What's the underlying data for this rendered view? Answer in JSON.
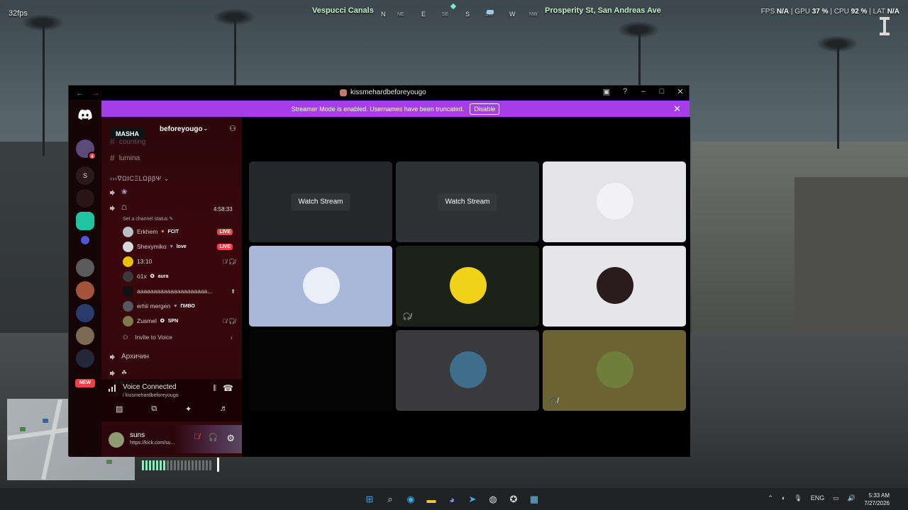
{
  "hud": {
    "fps": "32fps",
    "location_left": "Vespucci Canals",
    "location_right": "Prosperity St, San Andreas Ave",
    "compass": [
      "N",
      "NE",
      "E",
      "SE",
      "S",
      "SW",
      "W",
      "NW"
    ],
    "perf": {
      "fps_label": "FPS",
      "fps_value": "N/A",
      "gpu_label": "GPU",
      "gpu_value": "37 %",
      "cpu_label": "CPU",
      "cpu_value": "92 %",
      "lat_label": "LAT",
      "lat_value": "N/A"
    }
  },
  "window": {
    "title": "kissmehardbeforeyougo",
    "banner_text": "Streamer Mode is enabled. Usernames have been truncated.",
    "banner_button": "Disable"
  },
  "rail": {
    "dm_badge": "4",
    "new_label": "NEW",
    "server_s": "S"
  },
  "sidebar": {
    "tooltip": "MASHA",
    "server_name": "beforeyougo",
    "channels": [
      {
        "name": "counting"
      },
      {
        "name": "lumina"
      }
    ],
    "category": "›››∇ΩICΞLΩββΨ",
    "voice_timer": "4:58:33",
    "channel_status": "Set a channel status",
    "voice_users": [
      {
        "name": "Erkhem",
        "tag": "FCIT",
        "live": "LIVE",
        "color": "#b9bfc4"
      },
      {
        "name": "Shexymiko",
        "tag": "love",
        "live": "LIVE",
        "color": "#d5d9dd"
      },
      {
        "name": "13:10",
        "tag": "",
        "color": "#e6c300"
      },
      {
        "name": "ó1x",
        "tag": "aura",
        "color": "#3a3a3a"
      },
      {
        "name": "ааааааааааааааааааааа...",
        "tag": "",
        "color": "#111111"
      },
      {
        "name": "erhii mergen",
        "tag": "ПИВО",
        "color": "#55595c"
      },
      {
        "name": "Zusmel",
        "tag": "SPN",
        "color": "#7d7a52"
      }
    ],
    "invite_label": "Invite to Voice",
    "voice_channel_2": "Архичин"
  },
  "voice_panel": {
    "status": "Voice Connected",
    "channel": "/ kissmehardbeforeyougo"
  },
  "user_panel": {
    "name": "suns",
    "status": "https://kick.com/su..."
  },
  "stage": {
    "tiles": [
      {
        "type": "stream",
        "label": "Watch Stream",
        "bg": "#25282a"
      },
      {
        "type": "stream",
        "label": "Watch Stream",
        "bg": "#2f3234"
      },
      {
        "type": "avatar",
        "bg": "#e3e3e8",
        "avatar_color": "#f2f2f5"
      },
      {
        "type": "avatar",
        "bg": "#a9b8da",
        "avatar_color": "#e9eef8"
      },
      {
        "type": "avatar",
        "bg": "#1d2219",
        "avatar_color": "#f0d21a"
      },
      {
        "type": "avatar",
        "bg": "#e6e6e8",
        "avatar_color": "#2a1b1d"
      },
      {
        "type": "empty",
        "bg": "#050505"
      },
      {
        "type": "avatar",
        "bg": "#3a3a3c",
        "avatar_color": "#3f6d8c"
      },
      {
        "type": "avatar",
        "bg": "#6b6432",
        "avatar_color": "#6f7e3b"
      }
    ]
  },
  "taskbar": {
    "lang": "ENG",
    "time": "5:33 AM",
    "date": "7/27/2026"
  }
}
